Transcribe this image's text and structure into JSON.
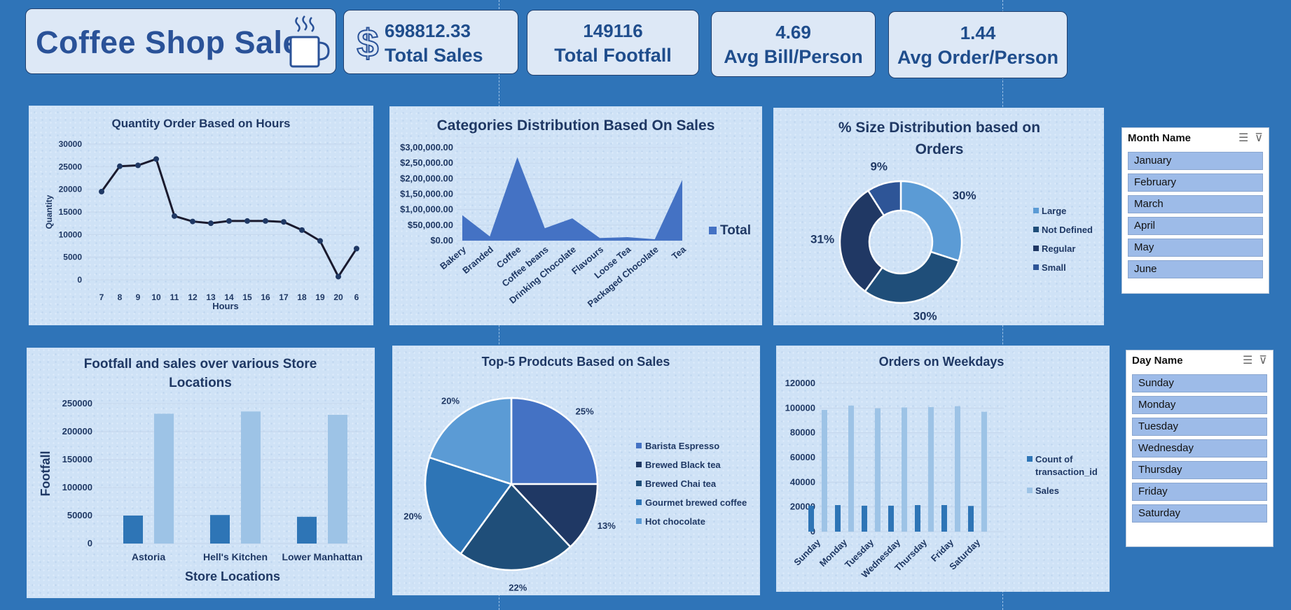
{
  "title": "Coffee Shop Sales",
  "kpis": [
    {
      "value": "698812.33",
      "label": "Total Sales"
    },
    {
      "value": "149116",
      "label": "Total Footfall"
    },
    {
      "value": "4.69",
      "label": "Avg Bill/Person"
    },
    {
      "value": "1.44",
      "label": "Avg Order/Person"
    }
  ],
  "icons": {
    "title_icon": "coffee-mug-icon",
    "sales_icon": "dollar-icon"
  },
  "colors": {
    "background": "#2f74b8",
    "navy": "#1f3864",
    "blue": "#4472c4",
    "light_blue": "#9dc3e6"
  },
  "chart_data": [
    {
      "type": "line",
      "title": "Quantity Order Based on Hours",
      "xlabel": "Hours",
      "ylabel": "Quantity",
      "x": [
        "7",
        "8",
        "9",
        "10",
        "11",
        "12",
        "13",
        "14",
        "15",
        "16",
        "17",
        "18",
        "19",
        "20",
        "6"
      ],
      "values": [
        19500,
        25100,
        25300,
        26700,
        14100,
        12900,
        12500,
        13000,
        13000,
        13000,
        12800,
        11000,
        8600,
        700,
        6900
      ],
      "ylim": [
        0,
        30000
      ],
      "yticks": [
        "30000",
        "25000",
        "20000",
        "15000",
        "10000",
        "5000",
        "0"
      ]
    },
    {
      "type": "area",
      "title": "Categories Distribution Based On Sales",
      "categories": [
        "Bakery",
        "Branded",
        "Coffee",
        "Coffee beans",
        "Drinking Chocolate",
        "Flavours",
        "Loose Tea",
        "Packaged Chocolate",
        "Tea"
      ],
      "series": [
        {
          "name": "Total",
          "values": [
            82000,
            13600,
            269000,
            40000,
            72000,
            8400,
            11200,
            4400,
            196000
          ]
        }
      ],
      "ylim": [
        0,
        300000
      ],
      "yticks": [
        "$3,00,000.00",
        "$2,50,000.00",
        "$2,00,000.00",
        "$1,50,000.00",
        "$1,00,000.00",
        "$50,000.00",
        "$0.00"
      ]
    },
    {
      "type": "pie",
      "title": "% Size Distribution based on Orders",
      "categories": [
        "Large",
        "Not Defined",
        "Regular",
        "Small"
      ],
      "values": [
        30,
        30,
        31,
        9
      ],
      "labels": [
        "30%",
        "30%",
        "31%",
        "9%"
      ],
      "colors": [
        "#5b9bd5",
        "#1f4e79",
        "#203864",
        "#2e5597"
      ],
      "donut": true
    },
    {
      "type": "bar",
      "title": "Footfall and sales over various Store Locations",
      "xlabel": "Store Locations",
      "ylabel": "Footfall",
      "categories": [
        "Astoria",
        "Hell's Kitchen",
        "Lower Manhattan"
      ],
      "series": [
        {
          "values": [
            50000,
            51000,
            47800
          ]
        },
        {
          "values": [
            232000,
            236000,
            230000
          ]
        }
      ],
      "ylim": [
        0,
        250000
      ],
      "yticks": [
        "250000",
        "200000",
        "150000",
        "100000",
        "50000",
        "0"
      ]
    },
    {
      "type": "pie",
      "title": "Top-5 Prodcuts Based on Sales",
      "categories": [
        "Barista Espresso",
        "Brewed Black tea",
        "Brewed Chai tea",
        "Gourmet brewed coffee",
        "Hot chocolate"
      ],
      "values": [
        25,
        13,
        22,
        20,
        20
      ],
      "labels": [
        "25%",
        "13%",
        "22%",
        "20%",
        "20%"
      ],
      "colors": [
        "#4472c4",
        "#1f3864",
        "#1f4e79",
        "#2e75b6",
        "#5b9bd5"
      ]
    },
    {
      "type": "bar",
      "title": "Orders on Weekdays",
      "categories": [
        "Sunday",
        "Monday",
        "Tuesday",
        "Wednesday",
        "Thursday",
        "Friday",
        "Saturday"
      ],
      "series": [
        {
          "name": "Count of transaction_id",
          "values": [
            21000,
            21500,
            21000,
            21000,
            21500,
            21500,
            20800
          ]
        },
        {
          "name": "Sales",
          "values": [
            98500,
            102000,
            99800,
            100500,
            100800,
            101500,
            97000
          ]
        }
      ],
      "ylim": [
        0,
        120000
      ],
      "yticks": [
        "120000",
        "100000",
        "80000",
        "60000",
        "40000",
        "20000",
        "0"
      ]
    }
  ],
  "slicers": [
    {
      "title": "Month Name",
      "items": [
        "January",
        "February",
        "March",
        "April",
        "May",
        "June"
      ]
    },
    {
      "title": "Day Name",
      "items": [
        "Sunday",
        "Monday",
        "Tuesday",
        "Wednesday",
        "Thursday",
        "Friday",
        "Saturday"
      ]
    }
  ]
}
